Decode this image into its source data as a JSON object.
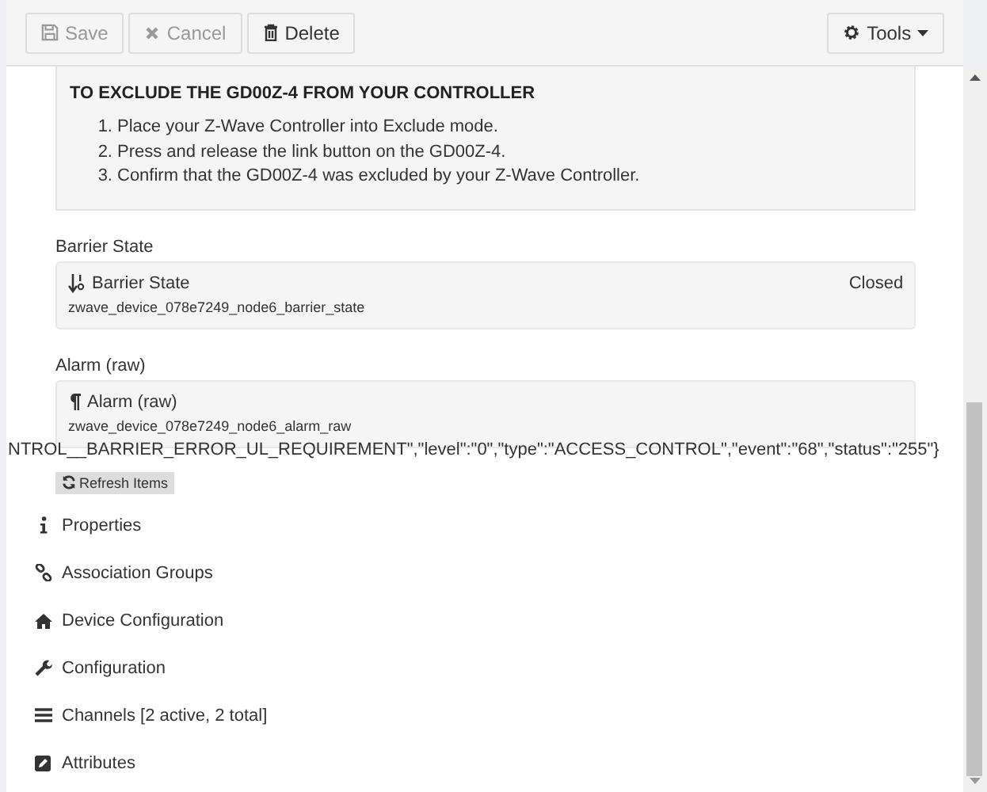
{
  "toolbar": {
    "buttons": [
      {
        "label": "Save",
        "disabled": true
      },
      {
        "label": "Cancel",
        "disabled": true
      },
      {
        "label": "Delete",
        "disabled": false
      }
    ],
    "tools": {
      "label": "Tools"
    }
  },
  "instructions": {
    "heading": "TO EXCLUDE THE GD00Z-4 FROM YOUR CONTROLLER",
    "steps": [
      {
        "marker": "1.",
        "text": "Place your Z-Wave Controller into Exclude mode."
      },
      {
        "marker": "2.",
        "text": "Press and release the link button on the GD00Z-4."
      },
      {
        "marker": "3.",
        "text": "Confirm that the GD00Z-4 was excluded by your Z-Wave Controller."
      }
    ]
  },
  "items": [
    {
      "label": "Barrier State",
      "name": "Barrier State",
      "id": "zwave_device_078e7249_node6_barrier_state",
      "state": "Closed"
    },
    {
      "label": "Alarm (raw)",
      "name": "Alarm (raw)",
      "id": "zwave_device_078e7249_node6_alarm_raw",
      "state": "NTROL__BARRIER_ERROR_UL_REQUIREMENT\",\"level\":\"0\",\"type\":\"ACCESS_CONTROL\",\"event\":\"68\",\"status\":\"255\"}"
    }
  ],
  "refresh_button": "Refresh Items",
  "sections": [
    "Properties",
    "Association Groups",
    "Device Configuration",
    "Configuration",
    "Channels [2 active, 2 total]",
    "Attributes"
  ]
}
